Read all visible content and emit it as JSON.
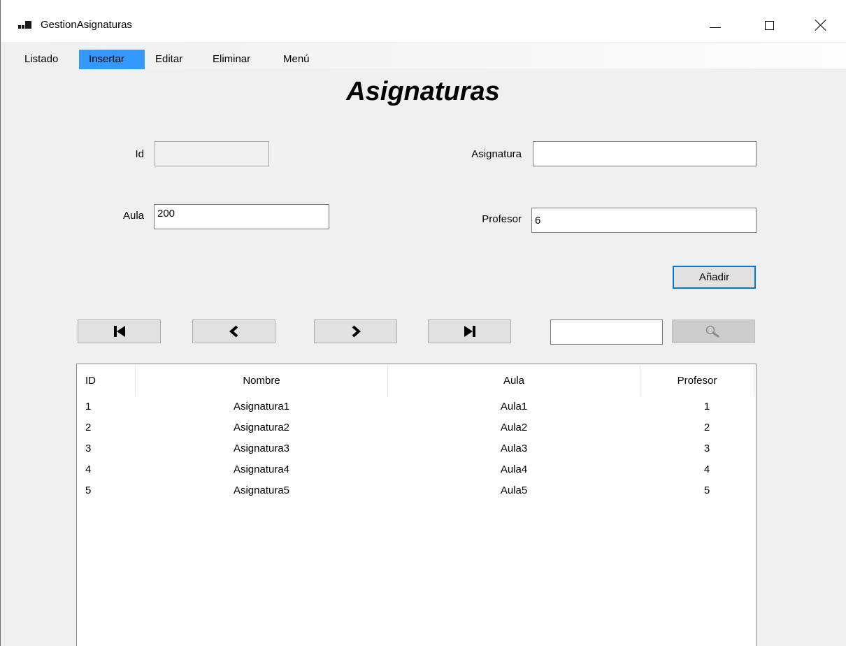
{
  "window": {
    "title": "GestionAsignaturas"
  },
  "menu": {
    "items": [
      {
        "label": "Listado",
        "selected": false
      },
      {
        "label": "Insertar",
        "selected": true
      },
      {
        "label": "Editar",
        "selected": false
      },
      {
        "label": "Eliminar",
        "selected": false
      },
      {
        "label": "Menú",
        "selected": false
      }
    ]
  },
  "form": {
    "heading": "Asignaturas",
    "id_label": "Id",
    "id_value": "",
    "asignatura_label": "Asignatura",
    "asignatura_value": "",
    "aula_label": "Aula",
    "aula_value": "200",
    "profesor_label": "Profesor",
    "profesor_value": "6",
    "add_button_label": "Añadir"
  },
  "navigation": {
    "first_icon": "first-record-icon",
    "prev_icon": "previous-record-icon",
    "next_icon": "next-record-icon",
    "last_icon": "last-record-icon",
    "search_value": "",
    "search_icon": "magnifier-icon"
  },
  "grid": {
    "columns": [
      "ID",
      "Nombre",
      "Aula",
      "Profesor"
    ],
    "rows": [
      [
        "1",
        "Asignatura1",
        "Aula1",
        "1"
      ],
      [
        "2",
        "Asignatura2",
        "Aula2",
        "2"
      ],
      [
        "3",
        "Asignatura3",
        "Aula3",
        "3"
      ],
      [
        "4",
        "Asignatura4",
        "Aula4",
        "4"
      ],
      [
        "5",
        "Asignatura5",
        "Aula5",
        "5"
      ]
    ]
  },
  "colors": {
    "menu_selected": "#3399ff",
    "button_focus_border": "#0078d7",
    "window_background": "#f0f0f0"
  }
}
